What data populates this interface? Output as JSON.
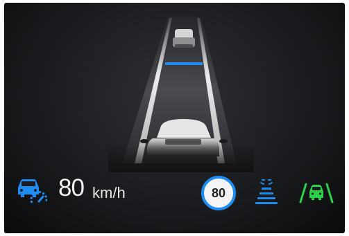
{
  "cruise": {
    "icon": "car-speedometer-icon",
    "speed_value": "80",
    "speed_unit": "km/h"
  },
  "speed_limit": {
    "value": "80"
  },
  "indicators": {
    "distance_icon": "following-distance-bars-icon",
    "lane_keep_icon": "lane-keeping-car-icon"
  },
  "colors": {
    "accent_blue": "#1f8cf2",
    "lane_green": "#2cd14a",
    "text": "#f2f2f2"
  }
}
